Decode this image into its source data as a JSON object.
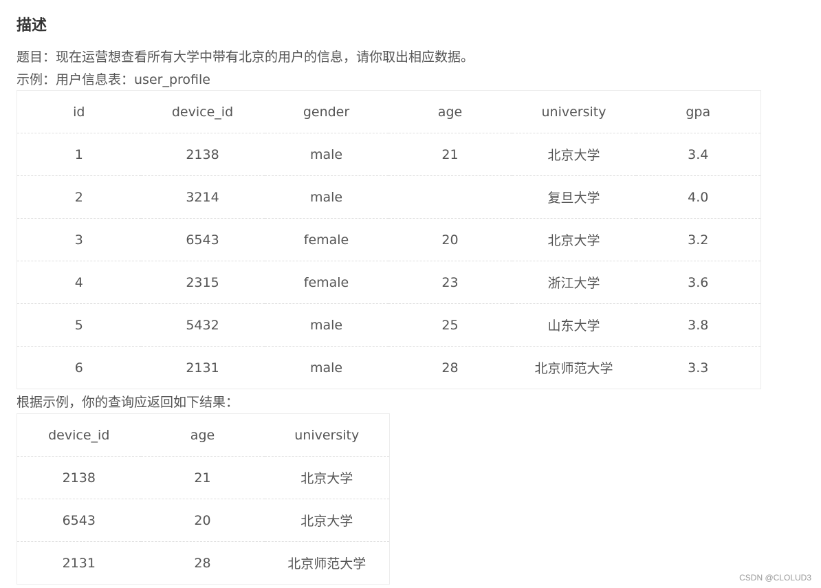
{
  "heading": "描述",
  "question": "题目：现在运营想查看所有大学中带有北京的用户的信息，请你取出相应数据。",
  "example_label": "示例：用户信息表：user_profile",
  "user_profile": {
    "columns": [
      "id",
      "device_id",
      "gender",
      "age",
      "university",
      "gpa"
    ],
    "rows": [
      [
        "1",
        "2138",
        "male",
        "21",
        "北京大学",
        "3.4"
      ],
      [
        "2",
        "3214",
        "male",
        "",
        "复旦大学",
        "4.0"
      ],
      [
        "3",
        "6543",
        "female",
        "20",
        "北京大学",
        "3.2"
      ],
      [
        "4",
        "2315",
        "female",
        "23",
        "浙江大学",
        "3.6"
      ],
      [
        "5",
        "5432",
        "male",
        "25",
        "山东大学",
        "3.8"
      ],
      [
        "6",
        "2131",
        "male",
        "28",
        "北京师范大学",
        "3.3"
      ]
    ]
  },
  "result_label": "根据示例，你的查询应返回如下结果：",
  "result": {
    "columns": [
      "device_id",
      "age",
      "university"
    ],
    "rows": [
      [
        "2138",
        "21",
        "北京大学"
      ],
      [
        "6543",
        "20",
        "北京大学"
      ],
      [
        "2131",
        "28",
        "北京师范大学"
      ]
    ]
  },
  "watermark": "CSDN @CLOLUD3"
}
